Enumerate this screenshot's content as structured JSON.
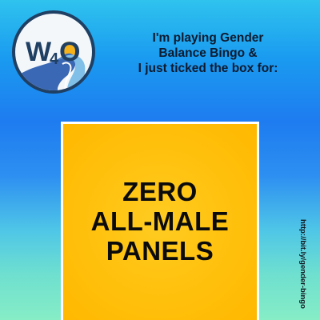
{
  "logo": {
    "icon": "w4o-logo-icon",
    "text_w": "W",
    "text_4": "4",
    "text_o": "O",
    "colors": {
      "ring": "#1f3f63",
      "fill": "#f4f7fa",
      "wave_dark": "#3a68b4",
      "wave_light": "#7fbfe8",
      "sun": "#f6b21a"
    }
  },
  "headline": {
    "line1": "I'm playing Gender",
    "line2": "Balance Bingo &",
    "line3": "I just ticked the box for:"
  },
  "card": {
    "line1": "ZERO",
    "line2": "ALL-MALE",
    "line3": "PANELS",
    "color": "#ffc20f"
  },
  "side_url": "http://bit.ly/gender-bingo"
}
